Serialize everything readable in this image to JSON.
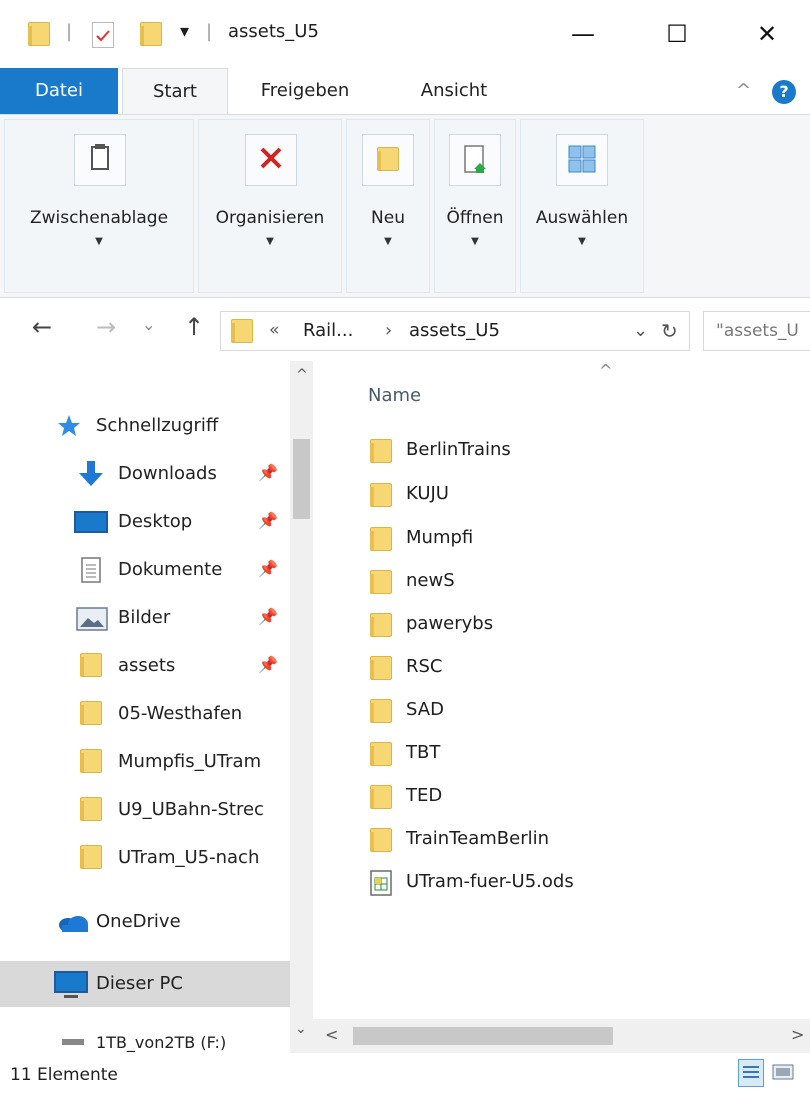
{
  "window": {
    "title": "assets_U5",
    "qat_separator": "|",
    "qat_dropdown": "▾",
    "minimize_glyph": "—",
    "maximize_glyph": "☐",
    "close_glyph": "✕"
  },
  "ribbon_tabs": {
    "file": "Datei",
    "start": "Start",
    "share": "Freigeben",
    "view": "Ansicht",
    "collapse_glyph": "^",
    "help_glyph": "?"
  },
  "ribbon": {
    "groups": [
      {
        "label": "Zwischenablage",
        "icon": "clipboard-icon"
      },
      {
        "label": "Organisieren",
        "icon": "delete-icon"
      },
      {
        "label": "Neu",
        "icon": "new-folder-icon"
      },
      {
        "label": "Öffnen",
        "icon": "open-icon"
      },
      {
        "label": "Auswählen",
        "icon": "select-icon"
      }
    ],
    "dropdown_glyph": "▼"
  },
  "address": {
    "back_glyph": "←",
    "forward_glyph": "→",
    "recent_glyph": "⌄",
    "up_glyph": "↑",
    "overflow": "«",
    "crumb_parent": "Rail...",
    "crumb_sep": "›",
    "crumb_current": "assets_U5",
    "dropdown_glyph": "⌄",
    "refresh_glyph": "↻",
    "search_text": "\"assets_U"
  },
  "nav": {
    "quick_access": "Schnellzugriff",
    "items": [
      {
        "label": "Downloads",
        "icon": "downloads-icon",
        "pinned": true
      },
      {
        "label": "Desktop",
        "icon": "desktop-icon",
        "pinned": true
      },
      {
        "label": "Dokumente",
        "icon": "documents-icon",
        "pinned": true
      },
      {
        "label": "Bilder",
        "icon": "pictures-icon",
        "pinned": true
      },
      {
        "label": "assets",
        "icon": "folder-icon",
        "pinned": true
      },
      {
        "label": "05-Westhafen",
        "icon": "folder-icon",
        "pinned": false
      },
      {
        "label": "Mumpfis_UTram",
        "icon": "folder-icon",
        "pinned": false
      },
      {
        "label": "U9_UBahn-Strec",
        "icon": "folder-icon",
        "pinned": false
      },
      {
        "label": "UTram_U5-nach",
        "icon": "folder-icon",
        "pinned": false
      }
    ],
    "onedrive": "OneDrive",
    "this_pc": "Dieser PC",
    "drive_partial": "1TB_von2TB (F:)",
    "pin_glyph": "📌",
    "scroll_up": "^",
    "scroll_down": "⌄"
  },
  "main": {
    "column_name": "Name",
    "sort_glyph": "^",
    "files": [
      {
        "name": "BerlinTrains",
        "type": "folder"
      },
      {
        "name": "KUJU",
        "type": "folder"
      },
      {
        "name": "Mumpfi",
        "type": "folder"
      },
      {
        "name": "newS",
        "type": "folder"
      },
      {
        "name": "pawerybs",
        "type": "folder"
      },
      {
        "name": "RSC",
        "type": "folder"
      },
      {
        "name": "SAD",
        "type": "folder"
      },
      {
        "name": "TBT",
        "type": "folder"
      },
      {
        "name": "TED",
        "type": "folder"
      },
      {
        "name": "TrainTeamBerlin",
        "type": "folder"
      },
      {
        "name": "UTram-fuer-U5.ods",
        "type": "spreadsheet"
      }
    ],
    "hscroll_left": "<",
    "hscroll_right": ">"
  },
  "status": {
    "count": "11 Elemente"
  },
  "colors": {
    "accent": "#1979ca",
    "folder": "#f7d774",
    "selection": "#d9d9d9"
  }
}
